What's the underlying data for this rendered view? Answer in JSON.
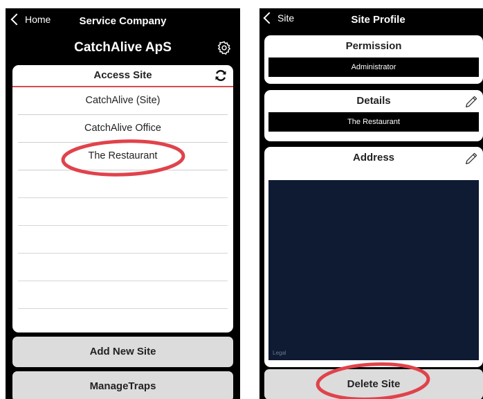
{
  "left_screen": {
    "nav": {
      "back_label": "Home",
      "title": "Service Company"
    },
    "company_name": "CatchAlive ApS",
    "access_card": {
      "title": "Access Site",
      "sites": [
        {
          "label": "CatchAlive (Site)"
        },
        {
          "label": "CatchAlive Office"
        },
        {
          "label": "The Restaurant"
        }
      ]
    },
    "buttons": {
      "add_new_site": "Add New Site",
      "manage_traps": "ManageTraps"
    }
  },
  "right_screen": {
    "nav": {
      "back_label": "Site",
      "title": "Site Profile"
    },
    "permission": {
      "title": "Permission",
      "value": "Administrator"
    },
    "details": {
      "title": "Details",
      "value": "The Restaurant"
    },
    "address": {
      "title": "Address",
      "map_watermark": "Legal"
    },
    "delete_button": "Delete Site"
  },
  "annotation_color": "#e0434b"
}
